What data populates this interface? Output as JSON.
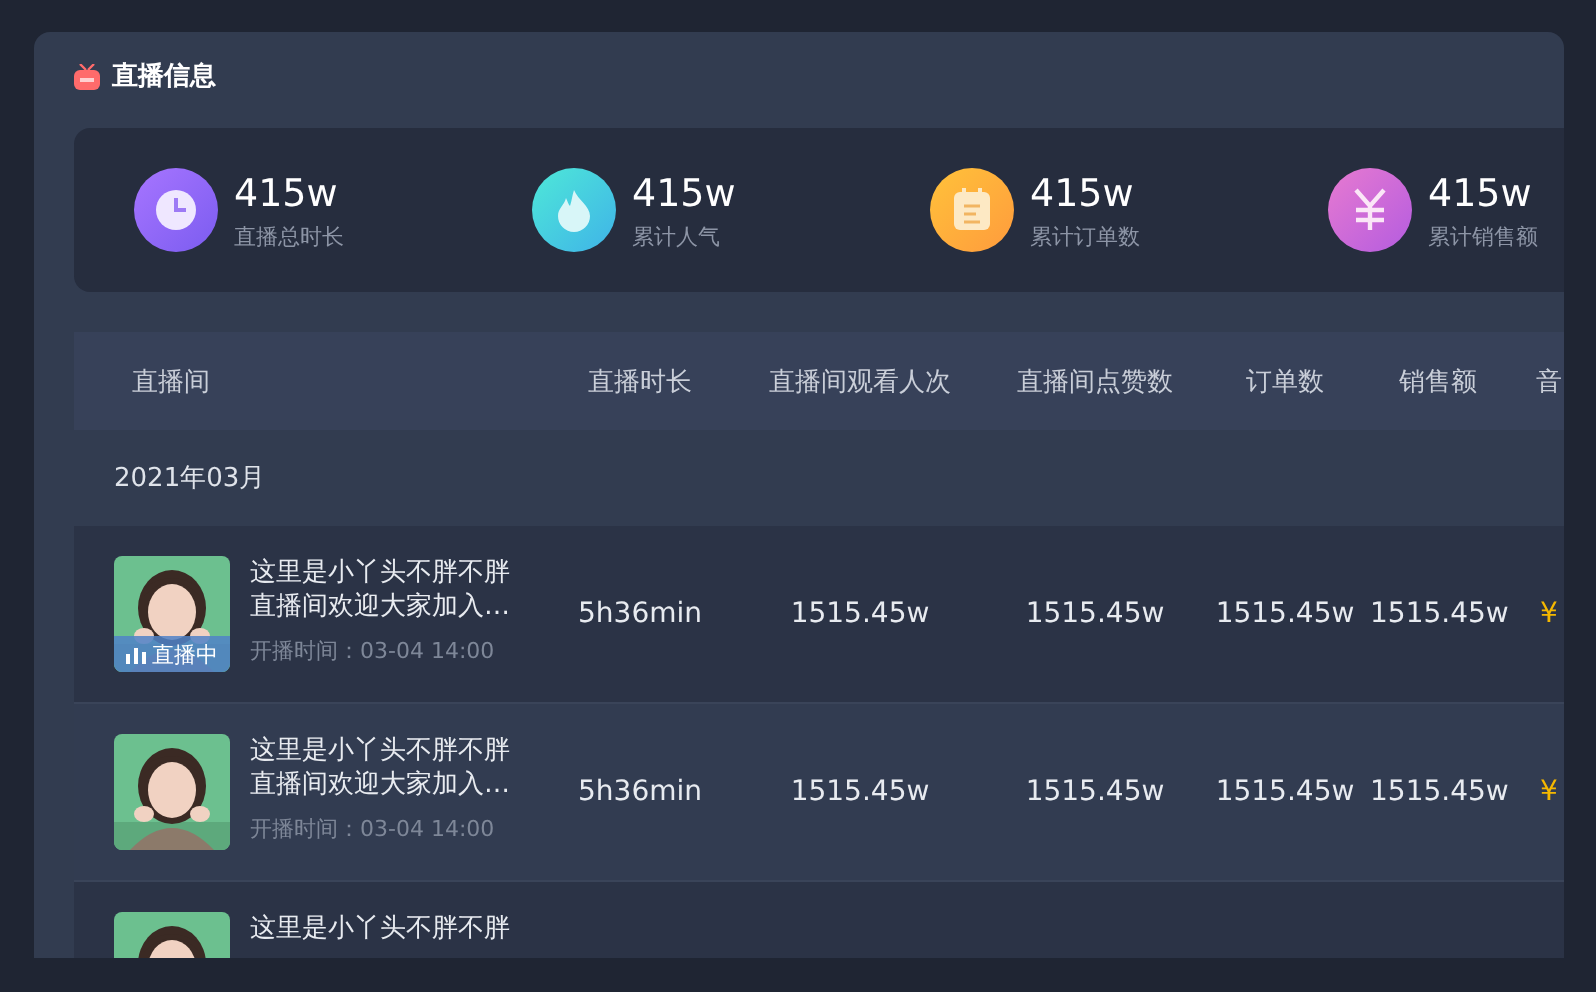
{
  "section": {
    "title": "直播信息"
  },
  "stats": [
    {
      "kind": "clock",
      "value": "415w",
      "label": "直播总时长"
    },
    {
      "kind": "flame",
      "value": "415w",
      "label": "累计人气"
    },
    {
      "kind": "notepad",
      "value": "415w",
      "label": "累计订单数"
    },
    {
      "kind": "yuan",
      "value": "415w",
      "label": "累计销售额"
    }
  ],
  "table": {
    "room_header": "直播间",
    "columns": [
      "直播时长",
      "直播间观看人次",
      "直播间点赞数",
      "订单数",
      "销售额",
      "音"
    ],
    "group": "2021年03月",
    "rows": [
      {
        "title": [
          "这里是小丫头不胖不胖",
          "直播间欢迎大家加入…"
        ],
        "start": "开播时间：03-04 14:00",
        "live": true,
        "live_label": "直播中",
        "cells": [
          "5h36min",
          "1515.45w",
          "1515.45w",
          "1515.45w",
          "1515.45w",
          "¥"
        ]
      },
      {
        "title": [
          "这里是小丫头不胖不胖",
          "直播间欢迎大家加入…"
        ],
        "start": "开播时间：03-04 14:00",
        "live": false,
        "cells": [
          "5h36min",
          "1515.45w",
          "1515.45w",
          "1515.45w",
          "1515.45w",
          "¥"
        ]
      },
      {
        "title": [
          "这里是小丫头不胖不胖"
        ],
        "live": false,
        "cells": []
      }
    ]
  }
}
